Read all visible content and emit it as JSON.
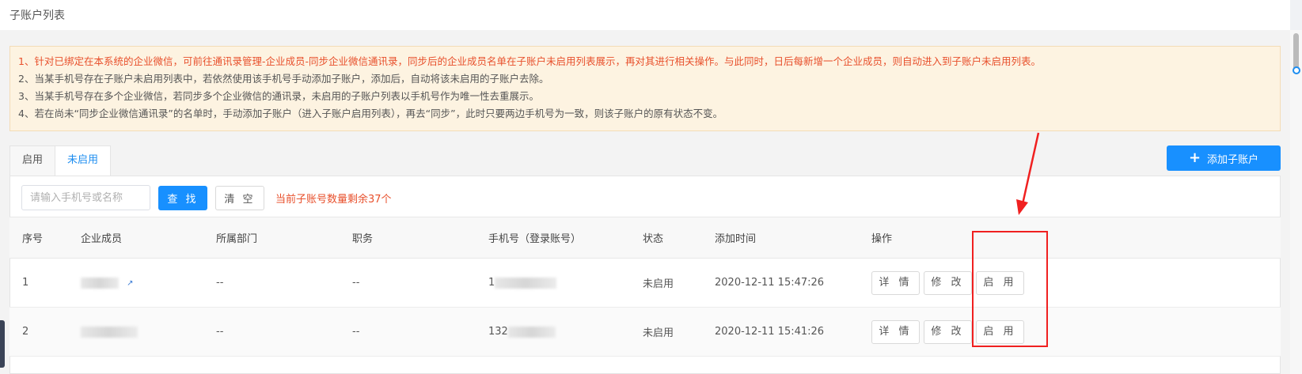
{
  "page": {
    "title": "子账户列表"
  },
  "notice": {
    "lines": [
      "1、针对已绑定在本系统的企业微信，可前往通讯录管理-企业成员-同步企业微信通讯录，同步后的企业成员名单在子账户未启用列表展示，再对其进行相关操作。与此同时，日后每新增一个企业成员，则自动进入到子账户未启用列表。",
      "2、当某手机号存在子账户未启用列表中，若依然使用该手机号手动添加子账户，添加后，自动将该未启用的子账户去除。",
      "3、当某手机号存在多个企业微信，若同步多个企业微信的通讯录，未启用的子账户列表以手机号作为唯一性去重展示。",
      "4、若在尚未“同步企业微信通讯录”的名单时，手动添加子账户（进入子账户启用列表），再去“同步”，此时只要两边手机号为一致，则该子账户的原有状态不变。"
    ],
    "highlight_color": "#e8502c"
  },
  "tabs": [
    {
      "label": "启用"
    },
    {
      "label": "未启用"
    }
  ],
  "toolbar": {
    "add_label": "添加子账户"
  },
  "filter": {
    "placeholder": "请输入手机号或名称",
    "search_label": "查 找",
    "clear_label": "清 空",
    "quota_text": "当前子账号数量剩余37个"
  },
  "table": {
    "headers": [
      "序号",
      "企业成员",
      "所属部门",
      "职务",
      "手机号（登录账号）",
      "状态",
      "添加时间",
      "操作"
    ],
    "rows": [
      {
        "index": "1",
        "dept": "--",
        "title": "--",
        "phone_prefix": "1",
        "status": "未启用",
        "added": "2020-12-11 15:47:26"
      },
      {
        "index": "2",
        "dept": "--",
        "title": "--",
        "phone_prefix": "132",
        "status": "未启用",
        "added": "2020-12-11 15:41:26"
      }
    ],
    "actions": {
      "detail": "详 情",
      "edit": "修 改",
      "enable": "启 用"
    }
  },
  "colors": {
    "primary": "#1890ff",
    "annotation": "#f02020"
  }
}
